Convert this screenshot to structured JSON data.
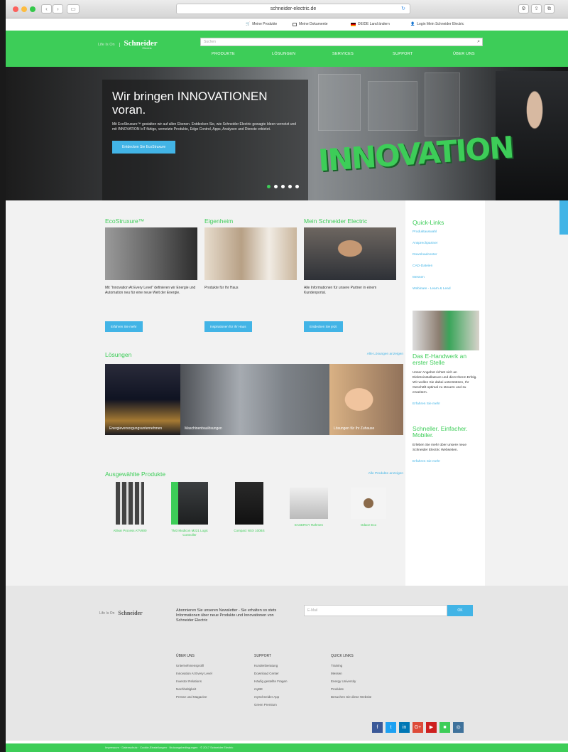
{
  "browser": {
    "url": "schneider-electric.de",
    "reload_icon": "reload-icon"
  },
  "utility": {
    "my_products": "Meine Produkte",
    "my_documents": "Meine Dokumente",
    "country": "DE/DE Land ändern",
    "login": "Login Mein Schneider Electric"
  },
  "header": {
    "tagline": "Life Is On",
    "brand": "Schneider",
    "brand_sub": "Electric",
    "search_placeholder": "Suchen",
    "nav": [
      "PRODUKTE",
      "LÖSUNGEN",
      "SERVICES",
      "SUPPORT",
      "ÜBER UNS"
    ]
  },
  "hero": {
    "title": "Wir bringen INNOVATIONEN voran.",
    "body": "Mit EcoStruxure™ gestalten wir auf allen Ebenen. Entdecken Sie, wie Schneider Electric gewagte Ideen vernetzt und mit INNOVATION IoT-fähige, vernetzte Produkte, Edge Control, Apps, Analysen und Dienste erbietet.",
    "cta": "Entdecken Sie EcoStruxure",
    "graphic_text": "INNOVATION",
    "slides": 5
  },
  "cards": [
    {
      "title": "EcoStruxure™",
      "text": "Mit “Innovation At Every Level” definieren wir Energie und Automation neu für eine neue Welt der Energie.",
      "button": "Erfahren Sie mehr"
    },
    {
      "title": "Eigenheim",
      "text": "Produkte für Ihr Haus",
      "button": "Inspirationen für Ihr Haus"
    },
    {
      "title": "Mein Schneider Electric",
      "text": "Alle Informationen für unsere Partner in einem Kundenportal.",
      "button": "Entdecken Sie jetzt"
    }
  ],
  "quick_links": {
    "title": "Quick-Links",
    "items": [
      "Produktauswahl",
      "Ansprechpartner",
      "Downloadcenter",
      "CAD-Dateien",
      "Messen",
      "Webinare - Learn & Lead"
    ]
  },
  "promo1": {
    "title": "Das E-Handwerk an erster Stelle",
    "text": "Unser Angebot richtet sich an Elektroinstallateure und dient Ihrem Erfolg. Wir wollen Sie dabei unterstützen, Ihr Geschäft optimal zu steuern und zu erweitern.",
    "link": "Erfahren Sie mehr"
  },
  "promo2": {
    "title": "Schneller. Einfacher. Mobiler.",
    "text": "Erleben Sie mehr über unsere neue Schneider Electric Webseiten.",
    "link": "Erfahren Sie mehr"
  },
  "solutions": {
    "title": "Lösungen",
    "link": "Alle Lösungen anzeigen",
    "items": [
      "Energieversorgungsunternehmen",
      "Maschinenbaulösungen",
      "Lösungen für Ihr Zuhause"
    ]
  },
  "products": {
    "title": "Ausgewählte Produkte",
    "link": "Alle Produkte anzeigen",
    "items": [
      "Altivar Process ATV900",
      "TM3 Modicon M221 Logic Controller",
      "Compact NSX 100BS",
      "EASERGY Rahmen",
      "Odace Eco"
    ]
  },
  "footer": {
    "brand": "Schneider",
    "tagline": "Life Is On",
    "newsletter": "Abonnieren Sie unseren Newsletter - Sie erhalten so stets Informationen über neue Produkte und Innovationen von Schneider Electric",
    "email_placeholder": "E-Mail",
    "ok": "OK",
    "columns": [
      {
        "title": "ÜBER UNS",
        "items": [
          "Unternehmensprofil",
          "Innovation At Every Level",
          "Investor Relations",
          "Nachhaltigkeit",
          "Presse und Magazine"
        ]
      },
      {
        "title": "SUPPORT",
        "items": [
          "Kundenberatung",
          "Download Center",
          "Häufig gestellte Fragen",
          "myBE",
          "mySchneider App",
          "Green Premium"
        ]
      },
      {
        "title": "QUICK LINKS",
        "items": [
          "Training",
          "Messen",
          "Energy University",
          "Produkte",
          "Besuchen Sie diese Website"
        ]
      }
    ],
    "social": [
      "f",
      "t",
      "in",
      "G+",
      "▶",
      "■",
      "◎"
    ],
    "bottom": "Impressum · Datenschutz · Cookie-Einstellungen · Nutzungsbedingungen · © 2017 Schneider Electric"
  },
  "colors": {
    "brand_green": "#3dcd58",
    "link_blue": "#42b4e6"
  }
}
